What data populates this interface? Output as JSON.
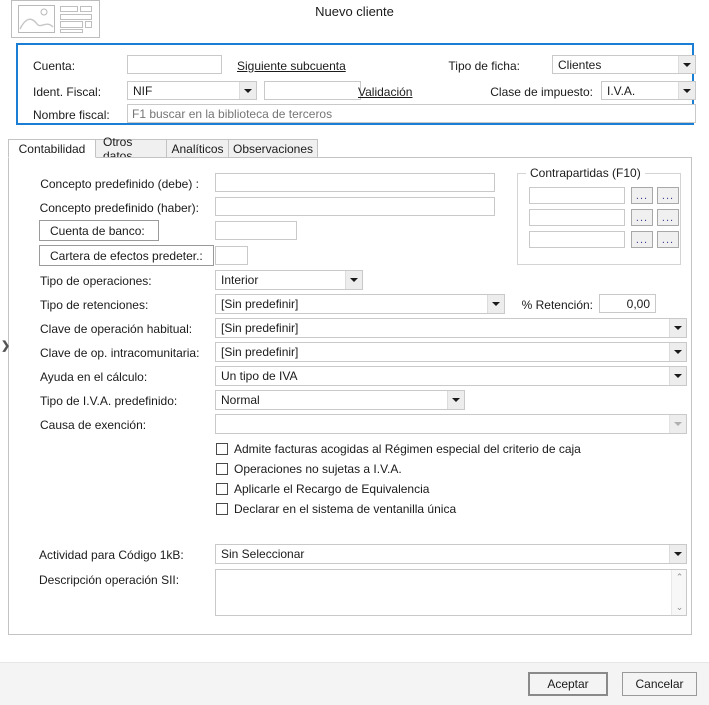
{
  "window": {
    "title": "Nuevo cliente",
    "icon": "form-card-icon"
  },
  "header_group": {
    "accent_color": "#1a7fd4",
    "cuenta_label": "Cuenta:",
    "cuenta_value": "",
    "siguiente_subcuenta_link": "Siguiente subcuenta",
    "tipo_ficha_label": "Tipo de ficha:",
    "tipo_ficha_value": "Clientes",
    "ident_fiscal_label": "Ident. Fiscal:",
    "ident_fiscal_type": "NIF",
    "ident_fiscal_value": "",
    "validacion_link": "Validación",
    "clase_impuesto_label": "Clase de impuesto:",
    "clase_impuesto_value": "I.V.A.",
    "nombre_fiscal_label": "Nombre fiscal:",
    "nombre_fiscal_value": "",
    "nombre_fiscal_placeholder": "F1 buscar en la biblioteca de terceros"
  },
  "tabs": [
    {
      "label": "Contabilidad",
      "active": true
    },
    {
      "label": "Otros datos",
      "active": false
    },
    {
      "label": "Analíticos",
      "active": false
    },
    {
      "label": "Observaciones",
      "active": false
    }
  ],
  "contabilidad": {
    "concepto_debe_label": "Concepto predefinido (debe) :",
    "concepto_debe_value": "",
    "concepto_haber_label": "Concepto predefinido (haber):",
    "concepto_haber_value": "",
    "cuenta_banco_button": "Cuenta de banco:",
    "cuenta_banco_value": "",
    "cartera_efectos_button": "Cartera de efectos predeter.:",
    "cartera_efectos_value": "",
    "tipo_operaciones_label": "Tipo de operaciones:",
    "tipo_operaciones_value": "Interior",
    "tipo_retenciones_label": "Tipo de retenciones:",
    "tipo_retenciones_value": "[Sin predefinir]",
    "pct_retencion_label": "% Retención:",
    "pct_retencion_value": "0,00",
    "clave_operacion_label": "Clave de operación habitual:",
    "clave_operacion_value": "[Sin predefinir]",
    "clave_intracomunitaria_label": "Clave de op. intracomunitaria:",
    "clave_intracomunitaria_value": "[Sin predefinir]",
    "ayuda_calculo_label": "Ayuda en el cálculo:",
    "ayuda_calculo_value": "Un tipo de IVA",
    "tipo_iva_label": "Tipo de I.V.A. predefinido:",
    "tipo_iva_value": "Normal",
    "causa_exencion_label": "Causa de exención:",
    "causa_exencion_value": "",
    "checkboxes": [
      {
        "label": "Admite facturas acogidas al Régimen especial del criterio de caja",
        "checked": false
      },
      {
        "label": "Operaciones no sujetas a I.V.A.",
        "checked": false
      },
      {
        "label": "Aplicarle el Recargo de Equivalencia",
        "checked": false
      },
      {
        "label": "Declarar en el sistema de ventanilla única",
        "checked": false
      }
    ],
    "actividad_label": "Actividad para Código 1kB:",
    "actividad_value": "Sin Seleccionar",
    "descripcion_sii_label": "Descripción operación SII:",
    "descripcion_sii_value": "",
    "contrapartidas": {
      "title": "Contrapartidas (F10)",
      "rows": [
        {
          "value": "",
          "btn1": "...",
          "btn2": "..."
        },
        {
          "value": "",
          "btn1": "...",
          "btn2": "..."
        },
        {
          "value": "",
          "btn1": "...",
          "btn2": "..."
        }
      ]
    }
  },
  "footer": {
    "accept_label": "Aceptar",
    "cancel_label": "Cancelar"
  },
  "misc": {
    "edge_caret": "❯",
    "scroll_up": "⌃",
    "scroll_down": "⌄"
  }
}
